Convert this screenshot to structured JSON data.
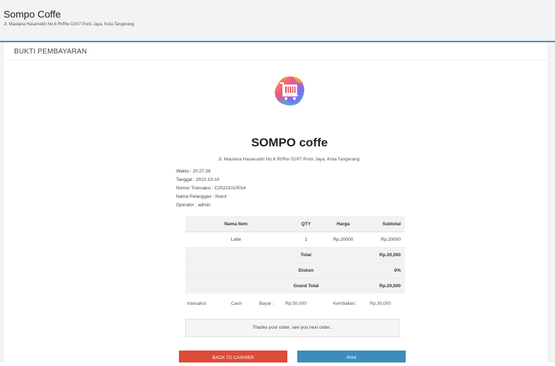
{
  "header": {
    "title": "Sompo Coffe",
    "address": "Jl. Maulana Hasanudin No.6 Rt/Rw 02/07 Poris Jaya, Kota Tangerang"
  },
  "card": {
    "title": "BUKTI PEMBAYARAN"
  },
  "receipt": {
    "logo_icon": "shopping-cart-icon",
    "shop_name": "SOMPO coffe",
    "shop_address": "Jl. Maulana Hasanudin No.6 Rt/Rw 02/07 Poris Jaya, Kota Tangerang",
    "info": [
      "Waktu : 20:27:28",
      "Tanggal : 2022-10-10",
      "Nomor Transaksi : C20221010014",
      "Nama Pelanggan : Nurul",
      "Operator : admin"
    ],
    "table": {
      "headers": [
        "Nama Item",
        "QTY",
        "Harga",
        "Subtotal"
      ],
      "rows": [
        {
          "item": "Latte",
          "qty": "1",
          "harga": "Rp.20000",
          "subtotal": "Rp.20000"
        }
      ],
      "summary": [
        {
          "label": "Total",
          "value": "Rp.20,000"
        },
        {
          "label": "Diskon",
          "value": "0%"
        },
        {
          "label": "Grand Total",
          "value": "Rp.20,000"
        }
      ]
    },
    "payment": {
      "transaksi_label": "transaksi:",
      "transaksi_value": "Cash",
      "bayar_label": "Bayar :",
      "bayar_value": "Rp.50,000",
      "kembalian_label": "Kembalian:",
      "kembalian_value": "Rp.30,000"
    },
    "thanks": "Thanks your order, see you next order.."
  },
  "buttons": {
    "back": "BACK TO CASHIER",
    "print": "Print"
  },
  "colors": {
    "accent_blue": "#3c8dbc",
    "danger_red": "#dd4b39",
    "cart_red": "#e8474c"
  }
}
